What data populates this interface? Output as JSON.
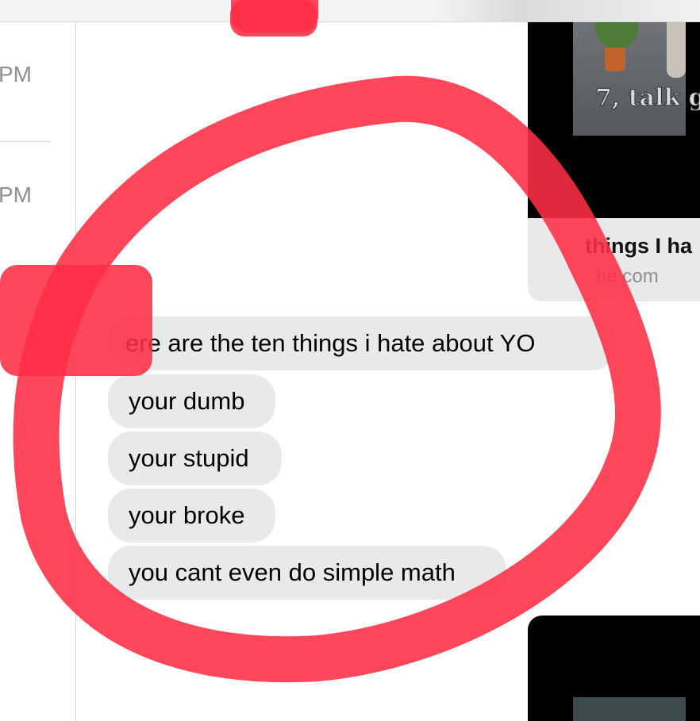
{
  "sidebar": {
    "timestamps": [
      "PM",
      "PM"
    ]
  },
  "video_top": {
    "caption": "7, talk g"
  },
  "link_card": {
    "title": "things I ha",
    "domain": "be.com"
  },
  "messages": [
    "ere are the ten things i hate about YO",
    "your dumb",
    "your stupid",
    "your broke",
    "you cant even do simple math"
  ],
  "colors": {
    "incoming_bubble": "#e9e9eb",
    "timestamp": "#8e8e93",
    "annotation_marker": "#ff2d46"
  }
}
